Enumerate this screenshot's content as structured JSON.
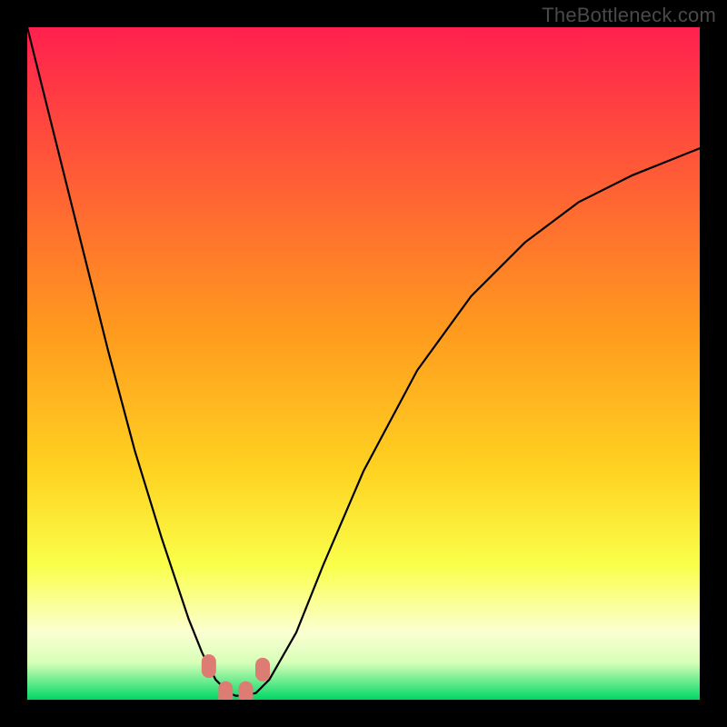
{
  "watermark": "TheBottleneck.com",
  "colors": {
    "black": "#000000",
    "curve": "#000000",
    "spot": "#dc7c73",
    "grad_top": "#ff204e",
    "grad_mid1": "#ff6a2a",
    "grad_mid2": "#ffd321",
    "grad_yellow": "#ffff62",
    "grad_pale": "#fcffdf",
    "grad_green": "#00e06a"
  },
  "chart_data": {
    "type": "line",
    "title": "",
    "xlabel": "",
    "ylabel": "",
    "x_range": [
      0,
      100
    ],
    "y_range": [
      0,
      100
    ],
    "series": [
      {
        "name": "bottleneck-curve",
        "x": [
          0,
          4,
          8,
          12,
          16,
          20,
          24,
          26,
          28,
          30,
          31,
          32,
          34,
          36,
          40,
          44,
          50,
          58,
          66,
          74,
          82,
          90,
          100
        ],
        "y": [
          100,
          84,
          68,
          52,
          37,
          24,
          12,
          7,
          3,
          1,
          0.6,
          0.6,
          1,
          3,
          10,
          20,
          34,
          49,
          60,
          68,
          74,
          78,
          82
        ]
      }
    ],
    "minimum_region": {
      "x_start": 27,
      "x_end": 35,
      "y_peak": 3.5
    },
    "gradient_stops": [
      {
        "offset": 0.0,
        "color": "#ff204e"
      },
      {
        "offset": 0.45,
        "color": "#ff9a1e"
      },
      {
        "offset": 0.66,
        "color": "#ffd321"
      },
      {
        "offset": 0.8,
        "color": "#f9ff4a"
      },
      {
        "offset": 0.9,
        "color": "#fbffd2"
      },
      {
        "offset": 0.945,
        "color": "#d7ffb8"
      },
      {
        "offset": 1.0,
        "color": "#00d865"
      }
    ]
  }
}
